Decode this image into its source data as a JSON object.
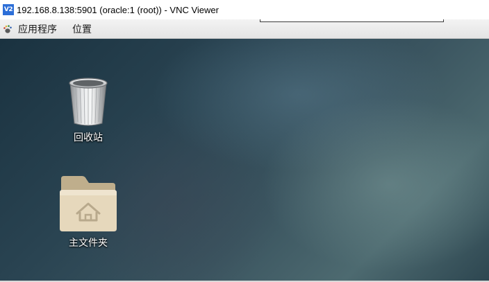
{
  "window": {
    "app_icon_text": "V2",
    "title": "192.168.8.138:5901 (oracle:1 (root)) - VNC Viewer"
  },
  "top_panel": {
    "menus": [
      {
        "label": "应用程序",
        "icon": "gnome-foot-icon"
      },
      {
        "label": "位置"
      }
    ]
  },
  "desktop": {
    "icons": [
      {
        "label": "回收站",
        "icon": "trash-icon"
      },
      {
        "label": "主文件夹",
        "icon": "home-folder-icon"
      }
    ]
  },
  "colors": {
    "title_bar": "#ffffff",
    "panel": "#ececec",
    "folder": "#d9c9a8",
    "app_icon": "#2d6fd8"
  }
}
